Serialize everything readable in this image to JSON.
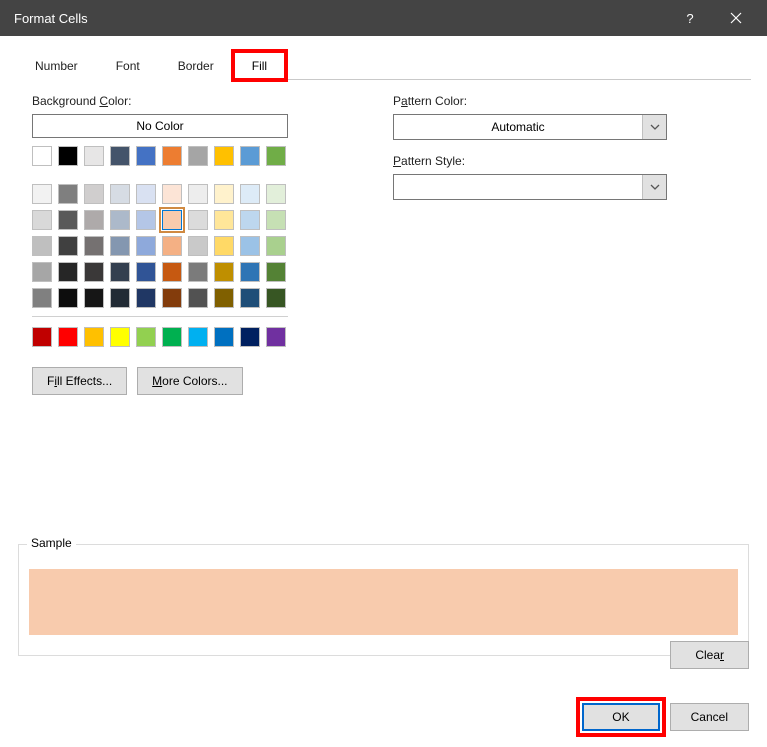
{
  "titlebar": {
    "title": "Format Cells"
  },
  "tabs": {
    "number": "Number",
    "font": "Font",
    "border": "Border",
    "fill": "Fill"
  },
  "left": {
    "bg_label_pre": "Background ",
    "bg_label_u": "C",
    "bg_label_post": "olor:",
    "no_color": "No Color",
    "fill_effects_pre": "F",
    "fill_effects_u": "i",
    "fill_effects_post": "ll Effects...",
    "more_colors_u": "M",
    "more_colors_post": "ore Colors..."
  },
  "right": {
    "pat_color_pre": "P",
    "pat_color_u": "a",
    "pat_color_post": "ttern Color:",
    "pat_color_value": "Automatic",
    "pat_style_u": "P",
    "pat_style_post": "attern Style:",
    "pat_style_value": ""
  },
  "sample": {
    "label": "Sample",
    "color": "#f8cbad"
  },
  "buttons": {
    "clear_pre": "Clea",
    "clear_u": "r",
    "ok": "OK",
    "cancel": "Cancel"
  },
  "palette": {
    "row1": [
      "#ffffff",
      "#000000",
      "#e7e6e6",
      "#44546a",
      "#4472c4",
      "#ed7d31",
      "#a5a5a5",
      "#ffc000",
      "#5b9bd5",
      "#70ad47"
    ],
    "tints": [
      [
        "#f2f2f2",
        "#7f7f7f",
        "#d0cece",
        "#d6dce4",
        "#d9e1f2",
        "#fce4d6",
        "#ededed",
        "#fff2cc",
        "#ddebf7",
        "#e2efda"
      ],
      [
        "#d9d9d9",
        "#595959",
        "#aeaaaa",
        "#acb9ca",
        "#b4c6e7",
        "#f8cbad",
        "#dbdbdb",
        "#ffe699",
        "#bdd7ee",
        "#c6e0b4"
      ],
      [
        "#bfbfbf",
        "#404040",
        "#757171",
        "#8497b0",
        "#8ea9db",
        "#f4b084",
        "#c9c9c9",
        "#ffd966",
        "#9bc2e6",
        "#a9d08e"
      ],
      [
        "#a6a6a6",
        "#262626",
        "#3a3838",
        "#333f4f",
        "#305496",
        "#c65911",
        "#7b7b7b",
        "#bf8f00",
        "#2f75b5",
        "#548235"
      ],
      [
        "#808080",
        "#0d0d0d",
        "#161616",
        "#222b35",
        "#203764",
        "#833c0c",
        "#525252",
        "#806000",
        "#1f4e78",
        "#375623"
      ]
    ],
    "standard": [
      "#c00000",
      "#ff0000",
      "#ffc000",
      "#ffff00",
      "#92d050",
      "#00b050",
      "#00b0f0",
      "#0070c0",
      "#002060",
      "#7030a0"
    ],
    "selected": "#f8cbad"
  }
}
